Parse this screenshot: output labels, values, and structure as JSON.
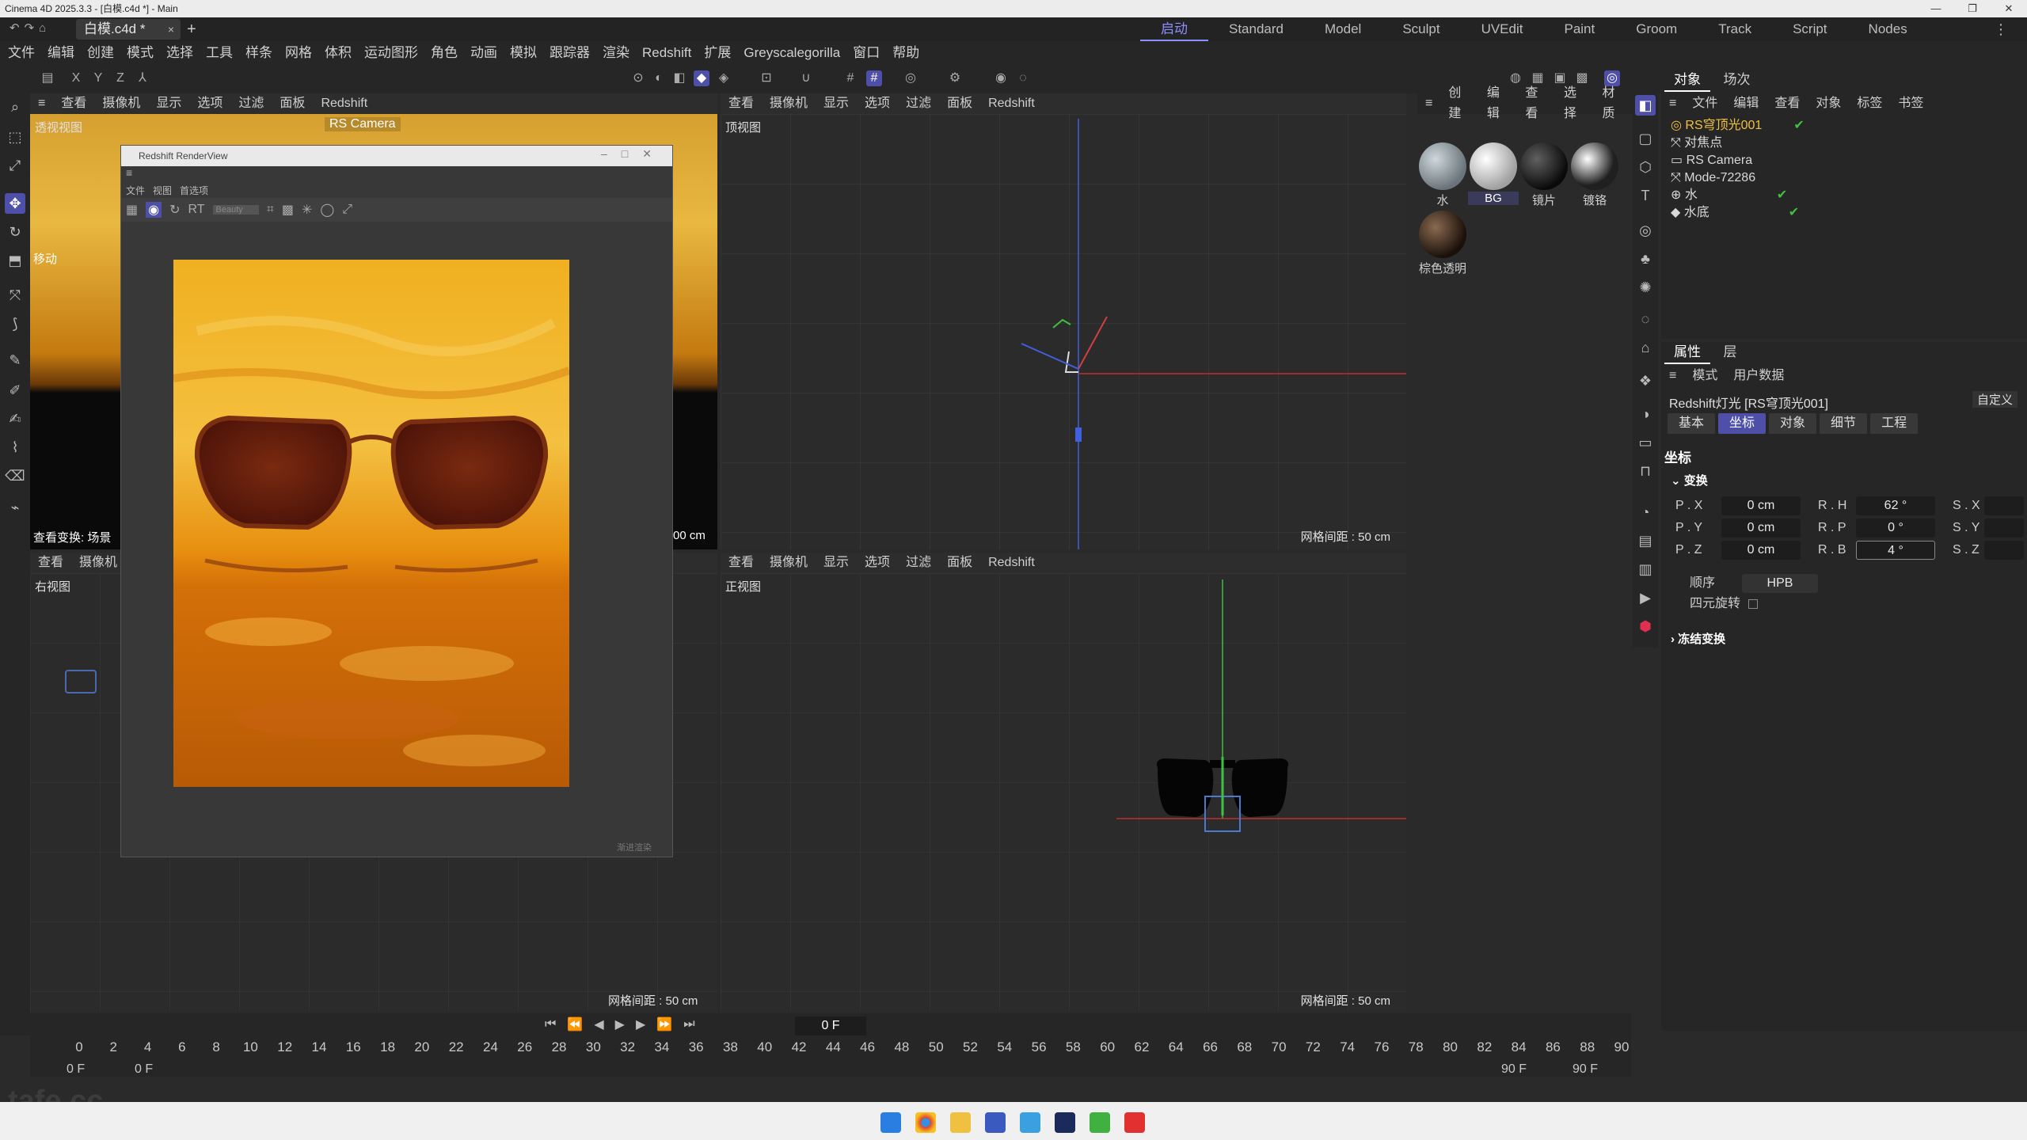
{
  "window": {
    "title": "Cinema 4D 2025.3.3 - [白模.c4d *] - Main",
    "controls": [
      "—",
      "❐",
      "✕"
    ]
  },
  "doc_tab": {
    "name": "白模.c4d *",
    "close": "×",
    "new": "+"
  },
  "layouts": [
    "启动",
    "Standard",
    "Model",
    "Sculpt",
    "UVEdit",
    "Paint",
    "Groom",
    "Track",
    "Script",
    "Nodes"
  ],
  "active_layout": "启动",
  "menu": [
    "文件",
    "编辑",
    "创建",
    "模式",
    "选择",
    "工具",
    "样条",
    "网格",
    "体积",
    "运动图形",
    "角色",
    "动画",
    "模拟",
    "跟踪器",
    "渲染",
    "Redshift",
    "扩展",
    "Greyscalegorilla",
    "窗口",
    "帮助"
  ],
  "axis_toggles": [
    "X",
    "Y",
    "Z"
  ],
  "viewport_menu": [
    "查看",
    "摄像机",
    "显示",
    "选项",
    "过滤",
    "面板",
    "Redshift"
  ],
  "viewport_menu_short": [
    "查看",
    "摄像机"
  ],
  "viewports": {
    "perspective": {
      "label": "透视视图",
      "camera": "RS Camera",
      "move_label": "移动",
      "status": "查看变换: 场景",
      "cut_text": "00 cm"
    },
    "top": {
      "label": "顶视图",
      "grid": "网格间距 : 50 cm"
    },
    "right": {
      "label": "右视图",
      "grid": "网格间距 : 50 cm"
    },
    "front": {
      "label": "正视图",
      "grid": "网格间距 : 50 cm"
    }
  },
  "render_view": {
    "title": "Redshift RenderView",
    "menu": [
      "文件",
      "视图",
      "首选项"
    ],
    "aov": "Beauty",
    "status": "渐进渲染"
  },
  "materials": {
    "menu": [
      "创建",
      "编辑",
      "查看",
      "选择",
      "材质"
    ],
    "items": [
      {
        "name": "水",
        "color": "#9aa3a8"
      },
      {
        "name": "BG",
        "color": "#e6e6e6"
      },
      {
        "name": "镜片",
        "color": "#1a1a1a"
      },
      {
        "name": "镀铬",
        "color": "#c0c0c0"
      },
      {
        "name": "棕色透明",
        "color": "#3a2a20"
      }
    ]
  },
  "object_manager": {
    "tabs": [
      "对象",
      "场次"
    ],
    "menu": [
      "文件",
      "编辑",
      "查看",
      "对象",
      "标签",
      "书签"
    ],
    "objects": [
      {
        "name": "RS穹顶光001",
        "selected": true
      },
      {
        "name": "对焦点",
        "selected": false
      },
      {
        "name": "RS Camera",
        "selected": false
      },
      {
        "name": "Mode-72286",
        "selected": false
      },
      {
        "name": "水",
        "selected": false
      },
      {
        "name": "水底",
        "selected": false
      }
    ]
  },
  "attributes": {
    "tabs": [
      "属性",
      "层"
    ],
    "menu": [
      "模式",
      "用户数据"
    ],
    "object_title": "Redshift灯光 [RS穹顶光001]",
    "preset": "自定义",
    "sub_tabs": [
      "基本",
      "坐标",
      "对象",
      "细节",
      "工程"
    ],
    "active_sub_tab": "坐标",
    "section": "坐标",
    "group_transform": "变换",
    "fields": [
      {
        "label": "P . X",
        "value": "0 cm"
      },
      {
        "label": "P . Y",
        "value": "0 cm"
      },
      {
        "label": "P . Z",
        "value": "0 cm"
      },
      {
        "label": "R . H",
        "value": "62 °"
      },
      {
        "label": "R . P",
        "value": "0 °"
      },
      {
        "label": "R . B",
        "value": "4 °"
      },
      {
        "label": "S . X",
        "value": ""
      },
      {
        "label": "S . Y",
        "value": ""
      },
      {
        "label": "S . Z",
        "value": ""
      }
    ],
    "order_label": "顺序",
    "order_value": "HPB",
    "quaternion_label": "四元旋转",
    "freeze_label": "冻结变换"
  },
  "timeline": {
    "current_frame": "0 F",
    "start": "0 F",
    "start2": "0 F",
    "end": "90 F",
    "end2": "90 F",
    "ticks": [
      "0",
      "2",
      "4",
      "6",
      "8",
      "10",
      "12",
      "14",
      "16",
      "18",
      "20",
      "22",
      "24",
      "26",
      "28",
      "30",
      "32",
      "34",
      "36",
      "38",
      "40",
      "42",
      "44",
      "46",
      "48",
      "50",
      "52",
      "54",
      "56",
      "58",
      "60",
      "62",
      "64",
      "66",
      "68",
      "70",
      "72",
      "74",
      "76",
      "78",
      "80",
      "82",
      "84",
      "86",
      "88",
      "90"
    ]
  },
  "colors": {
    "accent": "#4d4fa8",
    "selected_obj": "#f0c040",
    "axis_x": "#d04040",
    "axis_y": "#40c040",
    "axis_z": "#4060e0"
  },
  "watermark": "tafe.cc"
}
